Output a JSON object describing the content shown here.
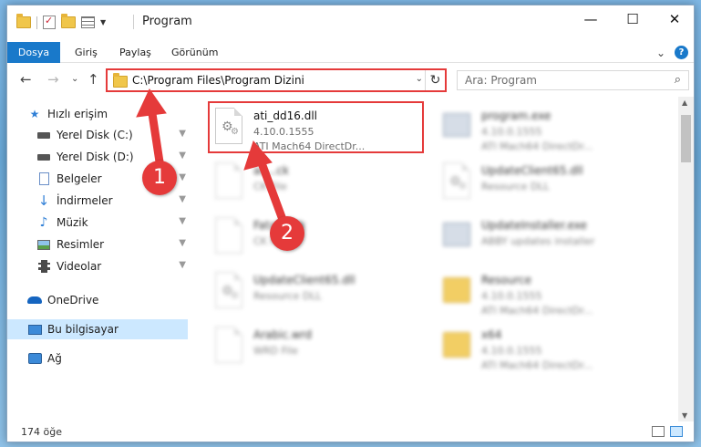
{
  "window": {
    "title": "Program",
    "controls": {
      "minimize": "—",
      "maximize": "☐",
      "close": "✕"
    }
  },
  "ribbon": {
    "tabs": [
      "Dosya",
      "Giriş",
      "Paylaş",
      "Görünüm"
    ],
    "collapse": "⌄",
    "help": "?"
  },
  "nav": {
    "back": "←",
    "forward": "→",
    "recent": "⌄",
    "up": "↑",
    "address": "C:\\Program Files\\Program Dizini",
    "address_drop": "⌄",
    "refresh": "↻",
    "search_placeholder": "Ara: Program",
    "search_icon": "⌕"
  },
  "sidebar": {
    "items": [
      {
        "label": "Hızlı erişim",
        "icon": "star-icon",
        "pinned": false
      },
      {
        "label": "Yerel Disk (C:)",
        "icon": "drive-icon",
        "pinned": true
      },
      {
        "label": "Yerel Disk (D:)",
        "icon": "drive-icon",
        "pinned": true
      },
      {
        "label": "Belgeler",
        "icon": "documents-icon",
        "pinned": true
      },
      {
        "label": "İndirmeler",
        "icon": "downloads-icon",
        "pinned": true
      },
      {
        "label": "Müzik",
        "icon": "music-icon",
        "pinned": true
      },
      {
        "label": "Resimler",
        "icon": "pictures-icon",
        "pinned": true
      },
      {
        "label": "Videolar",
        "icon": "videos-icon",
        "pinned": true
      },
      {
        "label": "OneDrive",
        "icon": "cloud-icon",
        "pinned": false
      },
      {
        "label": "Bu bilgisayar",
        "icon": "computer-icon",
        "pinned": false,
        "selected": true
      },
      {
        "label": "Ağ",
        "icon": "network-icon",
        "pinned": false
      }
    ],
    "pin_glyph": "📌"
  },
  "files": [
    {
      "name": "ati_dd16.dll",
      "line1": "4.10.0.1555",
      "line2": "ATI Mach64 DirectDr...",
      "icon": "dll-file-icon",
      "blurred": false
    },
    {
      "name": "program.exe",
      "line1": "4.10.0.1555",
      "line2": "ATI Mach64 DirectDr...",
      "icon": "exe-file-icon",
      "blurred": true
    },
    {
      "name": "ac...ck",
      "line1": "CK File",
      "line2": "",
      "icon": "file-icon",
      "blurred": true
    },
    {
      "name": "UpdateClient65.dll",
      "line1": "Resource DLL",
      "line2": "",
      "icon": "dll-file-icon",
      "blurred": true
    },
    {
      "name": "Fatal....ck",
      "line1": "CK File",
      "line2": "",
      "icon": "file-icon",
      "blurred": true
    },
    {
      "name": "UpdateInstaller.exe",
      "line1": "ABBY updates installer",
      "line2": "",
      "icon": "exe-file-icon",
      "blurred": true
    },
    {
      "name": "UpdateClient65.dll",
      "line1": "Resource DLL",
      "line2": "",
      "icon": "dll-file-icon",
      "blurred": true
    },
    {
      "name": "Resource",
      "line1": "4.10.0.1555",
      "line2": "ATI Mach64 DirectDr...",
      "icon": "folder-icon",
      "blurred": true
    },
    {
      "name": "Arabic.wrd",
      "line1": "WRD File",
      "line2": "",
      "icon": "file-icon",
      "blurred": true
    },
    {
      "name": "x64",
      "line1": "4.10.0.1555",
      "line2": "ATI Mach64 DirectDr...",
      "icon": "folder-icon",
      "blurred": true
    }
  ],
  "status": {
    "count": "174 öğe"
  },
  "annotations": {
    "callout1": "1",
    "callout2": "2",
    "color": "#e53a3a"
  }
}
